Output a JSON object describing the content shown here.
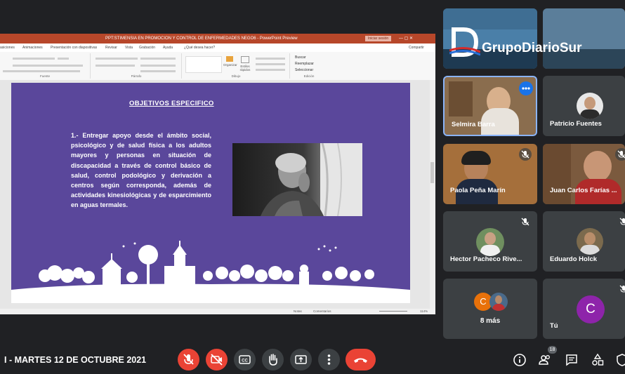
{
  "ppt": {
    "window_title": "PPT:STIMENSIA EN PROMOCION Y CONTROL DE ENFERMEDADES NEGO6 - PowerPoint Preview",
    "signin_label": "Iniciar sesión",
    "share_label": "Compartir",
    "menu": [
      "asiciones",
      "Animaciones",
      "Presentación con diapositivas",
      "Revisar",
      "Vista",
      "Grabación",
      "Ayuda",
      "¿Qué desea hacer?"
    ],
    "ribbon_groups": [
      "Fuente",
      "Párrafo",
      "Dibujo",
      "Edición"
    ],
    "ribbon_buttons": {
      "organize": "Organizar",
      "styles": "Estilos rápidos",
      "find": "Buscar",
      "replace": "Reemplazar",
      "select": "Seleccionar"
    },
    "status": {
      "notes": "Notas",
      "comments": "Comentarios",
      "zoom": "114%"
    }
  },
  "slide": {
    "title": "OBJETIVOS ESPECIFICO",
    "body": "1.- Entregar apoyo desde el ámbito social, psicológico y de salud física a los adultos mayores y personas en situación de discapacidad a través de control básico de salud, control podológico y derivación a centros según corresponda, además de actividades kinesiológicas y de esparcimiento en aguas termales."
  },
  "watermark": {
    "text": "GrupoDiarioSur"
  },
  "participants": [
    {
      "name": "",
      "muted": false
    },
    {
      "name": "",
      "muted": false
    },
    {
      "name": "Selmira Barra",
      "muted": false
    },
    {
      "name": "Patricio Fuentes",
      "muted": false
    },
    {
      "name": "Paola Peña Marín",
      "muted": true
    },
    {
      "name": "Juan Carlos Farías ...",
      "muted": true
    },
    {
      "name": "Hector Pacheco Rive...",
      "muted": true
    },
    {
      "name": "Eduardo Holck",
      "muted": true
    },
    {
      "name": "8 más",
      "muted": false
    },
    {
      "name": "Tú",
      "muted": true
    }
  ],
  "more_tile": {
    "avatar_letter": "C"
  },
  "you_tile": {
    "avatar_letter": "C"
  },
  "bottom": {
    "date": "I - MARTES 12 DE OCTUBRE 2021",
    "participants_badge": "18",
    "icons": [
      "mic-off-icon",
      "camera-off-icon",
      "captions-icon",
      "raise-hand-icon",
      "present-icon",
      "more-options-icon",
      "end-call-icon",
      "info-icon",
      "people-icon",
      "chat-icon",
      "activities-icon",
      "shield-icon"
    ]
  },
  "colors": {
    "meet_bg": "#202124",
    "tile_bg": "#3c4043",
    "slide_bg": "#5a479b",
    "ppt_accent": "#b7472a",
    "danger": "#ea4335",
    "speaking": "#8ab4f8"
  }
}
